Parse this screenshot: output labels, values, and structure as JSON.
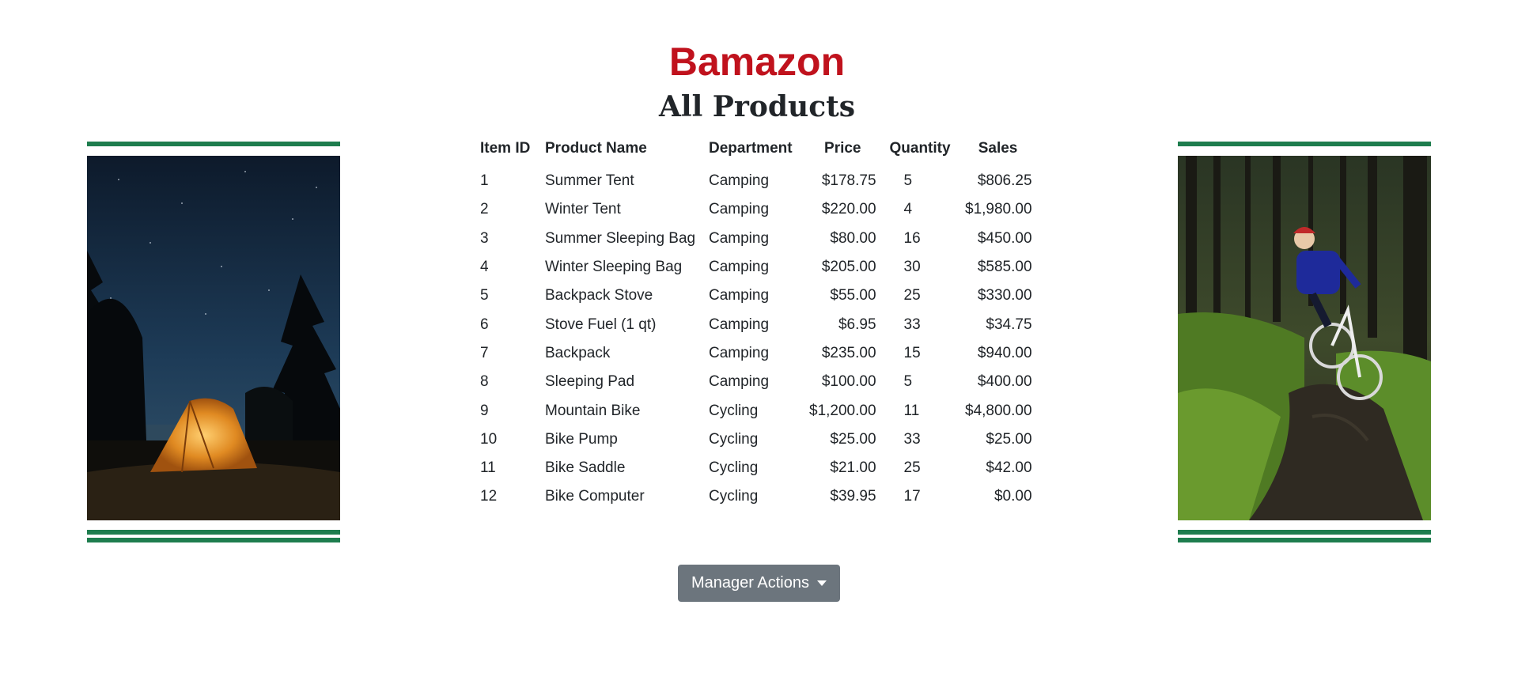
{
  "header": {
    "brand": "Bamazon",
    "subtitle": "All Products"
  },
  "images": {
    "left": "tent-at-night-photo",
    "right": "mountain-biker-photo"
  },
  "table": {
    "columns": [
      "Item ID",
      "Product Name",
      "Department",
      "Price",
      "Quantity",
      "Sales"
    ],
    "rows": [
      [
        "1",
        "Summer Tent",
        "Camping",
        "$178.75",
        "5",
        "$806.25"
      ],
      [
        "2",
        "Winter Tent",
        "Camping",
        "$220.00",
        "4",
        "$1,980.00"
      ],
      [
        "3",
        "Summer Sleeping Bag",
        "Camping",
        "$80.00",
        "16",
        "$450.00"
      ],
      [
        "4",
        "Winter Sleeping Bag",
        "Camping",
        "$205.00",
        "30",
        "$585.00"
      ],
      [
        "5",
        "Backpack Stove",
        "Camping",
        "$55.00",
        "25",
        "$330.00"
      ],
      [
        "6",
        "Stove Fuel (1 qt)",
        "Camping",
        "$6.95",
        "33",
        "$34.75"
      ],
      [
        "7",
        "Backpack",
        "Camping",
        "$235.00",
        "15",
        "$940.00"
      ],
      [
        "8",
        "Sleeping Pad",
        "Camping",
        "$100.00",
        "5",
        "$400.00"
      ],
      [
        "9",
        "Mountain Bike",
        "Cycling",
        "$1,200.00",
        "11",
        "$4,800.00"
      ],
      [
        "10",
        "Bike Pump",
        "Cycling",
        "$25.00",
        "33",
        "$25.00"
      ],
      [
        "11",
        "Bike Saddle",
        "Cycling",
        "$21.00",
        "25",
        "$42.00"
      ],
      [
        "12",
        "Bike Computer",
        "Cycling",
        "$39.95",
        "17",
        "$0.00"
      ]
    ]
  },
  "actions": {
    "dropdown_label": "Manager Actions"
  },
  "colors": {
    "brand": "#c0121d",
    "accent_bar": "#1e7d4e",
    "button_bg": "#6c757d"
  }
}
